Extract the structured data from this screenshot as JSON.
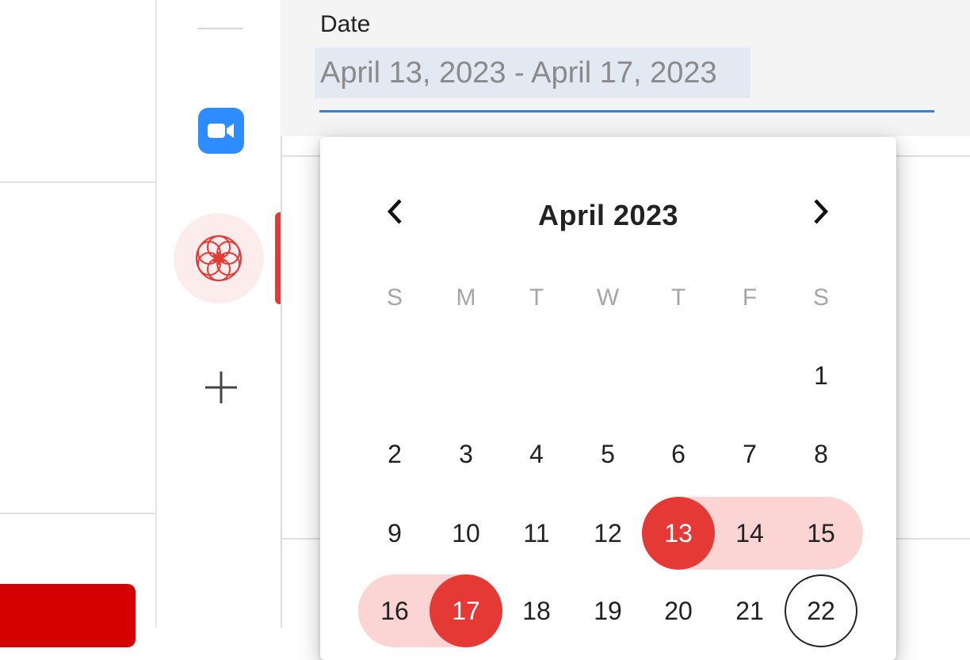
{
  "date_field": {
    "label": "Date",
    "value": "April 13, 2023 - April 17, 2023"
  },
  "calendar": {
    "month_title": "April 2023",
    "prev_icon": "chevron-left-icon",
    "next_icon": "chevron-right-icon",
    "weekdays": [
      "S",
      "M",
      "T",
      "W",
      "T",
      "F",
      "S"
    ],
    "selected_start": "13",
    "selected_end": "17",
    "today": "22",
    "rows": [
      [
        "",
        "",
        "",
        "",
        "",
        "",
        "1"
      ],
      [
        "2",
        "3",
        "4",
        "5",
        "6",
        "7",
        "8"
      ],
      [
        "9",
        "10",
        "11",
        "12",
        "13",
        "14",
        "15"
      ],
      [
        "16",
        "17",
        "18",
        "19",
        "20",
        "21",
        "22"
      ]
    ]
  },
  "rail": {
    "items": [
      {
        "icon": "zoom-video-icon"
      },
      {
        "icon": "flower-logo-icon",
        "active": true
      },
      {
        "icon": "plus-icon"
      }
    ]
  },
  "colors": {
    "accent_red": "#e53935",
    "range_fill": "#fdd4d4",
    "input_underline": "#3b7ddd",
    "input_highlight": "#e3e9f2",
    "zoom_blue": "#2d8cff"
  }
}
